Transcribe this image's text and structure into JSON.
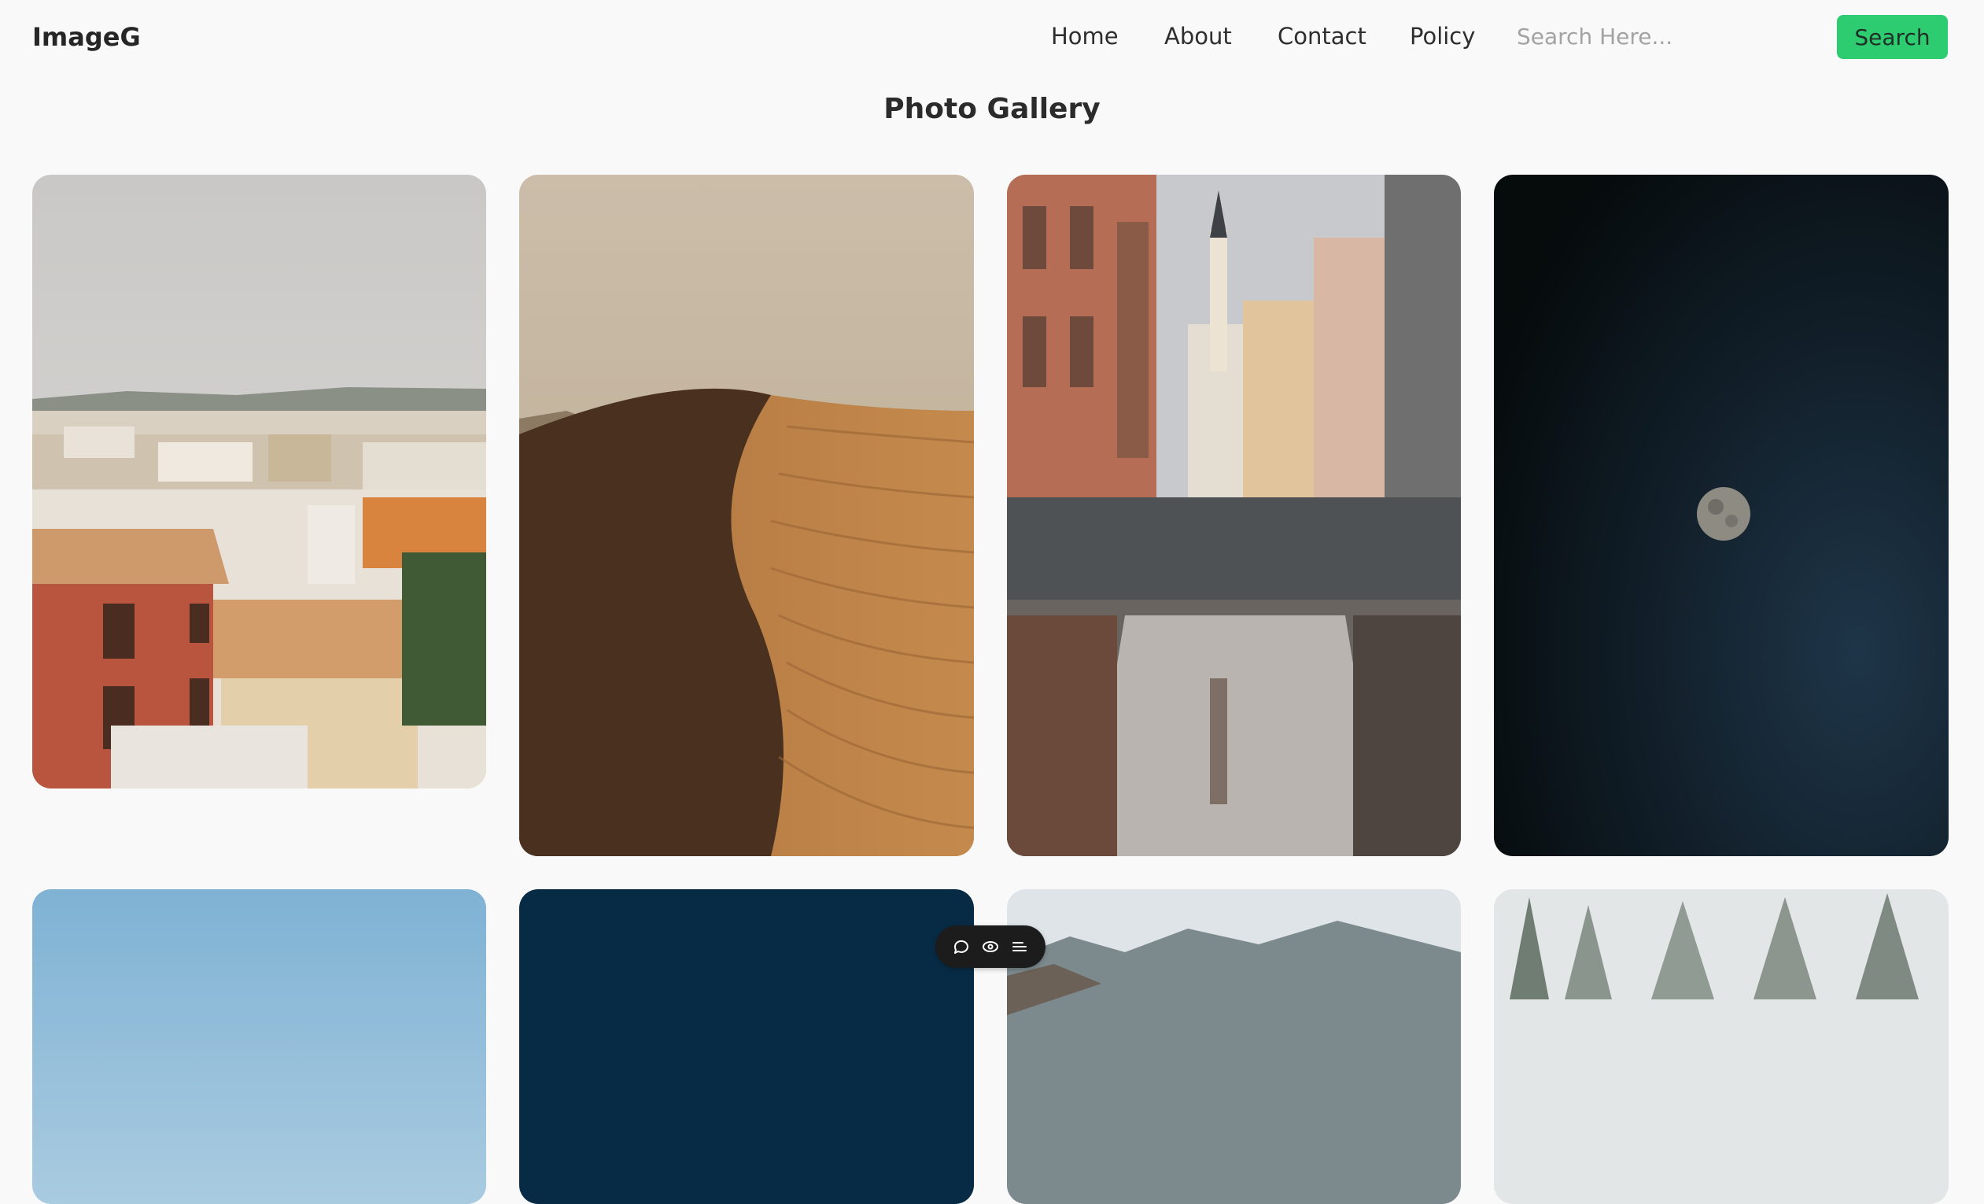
{
  "header": {
    "logo": "ImageG",
    "nav": [
      "Home",
      "About",
      "Contact",
      "Policy"
    ],
    "search": {
      "placeholder": "Search Here...",
      "value": "",
      "button_label": "Search"
    }
  },
  "main": {
    "title": "Photo Gallery",
    "photos": [
      {
        "subject": "rooftops-of-town"
      },
      {
        "subject": "desert-sand-dune"
      },
      {
        "subject": "cobblestone-street-reflection"
      },
      {
        "subject": "moon-in-night-sky"
      },
      {
        "subject": "blue-sky"
      },
      {
        "subject": "deep-blue"
      },
      {
        "subject": "mountains-and-clouds"
      },
      {
        "subject": "misty-forest"
      }
    ]
  },
  "toolbar": {
    "icons": [
      "comment-icon",
      "eye-icon",
      "menu-icon"
    ]
  },
  "colors": {
    "accent": "#2ecc71",
    "background": "#f9f9f9",
    "text": "#2b2b2b"
  }
}
